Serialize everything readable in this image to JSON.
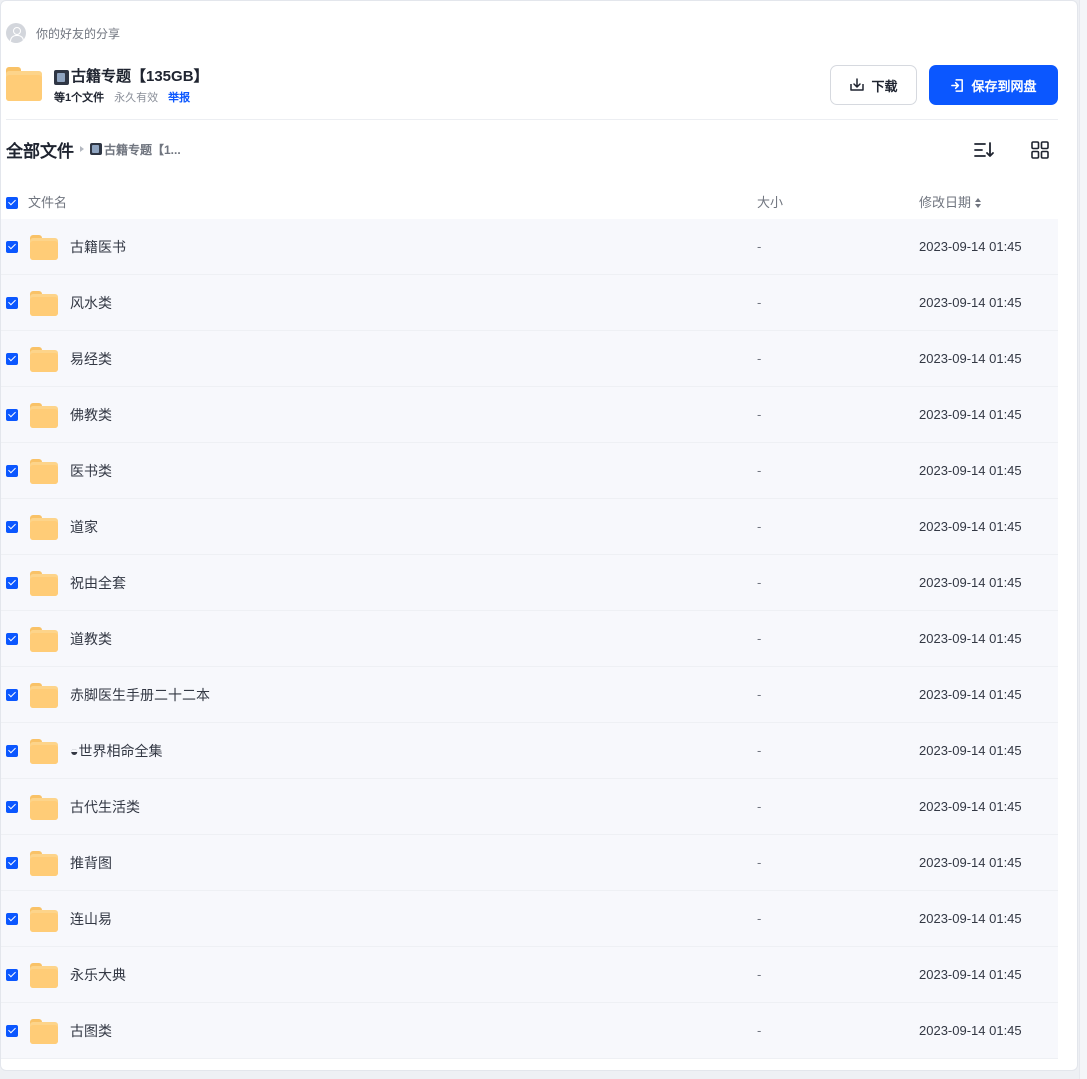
{
  "sharer": {
    "text": "你的好友的分享",
    "avatar_icon": "user-avatar-icon"
  },
  "share": {
    "title": "古籍专题【135GB】",
    "title_icon": "book-icon",
    "file_count": "等1个文件",
    "validity": "永久有效",
    "report_label": "举报"
  },
  "actions": {
    "download_label": "下载",
    "save_label": "保存到网盘",
    "primary_color": "#0b57ff"
  },
  "breadcrumb": {
    "root": "全部文件",
    "current": "古籍专题【1..."
  },
  "view_controls": {
    "list_icon": "list-sort-icon",
    "grid_icon": "grid-view-icon"
  },
  "table": {
    "columns": {
      "name": "文件名",
      "size": "大小",
      "date": "修改日期"
    },
    "rows": [
      {
        "name": "古籍医书",
        "size": "-",
        "date": "2023-09-14 01:45"
      },
      {
        "name": "风水类",
        "size": "-",
        "date": "2023-09-14 01:45"
      },
      {
        "name": "易经类",
        "size": "-",
        "date": "2023-09-14 01:45"
      },
      {
        "name": "佛教类",
        "size": "-",
        "date": "2023-09-14 01:45"
      },
      {
        "name": "医书类",
        "size": "-",
        "date": "2023-09-14 01:45"
      },
      {
        "name": "道家",
        "size": "-",
        "date": "2023-09-14 01:45"
      },
      {
        "name": "祝由全套",
        "size": "-",
        "date": "2023-09-14 01:45"
      },
      {
        "name": "道教类",
        "size": "-",
        "date": "2023-09-14 01:45"
      },
      {
        "name": "赤脚医生手册二十二本",
        "size": "-",
        "date": "2023-09-14 01:45"
      },
      {
        "name": "◒世界相命全集",
        "size": "-",
        "date": "2023-09-14 01:45"
      },
      {
        "name": "古代生活类",
        "size": "-",
        "date": "2023-09-14 01:45"
      },
      {
        "name": "推背图",
        "size": "-",
        "date": "2023-09-14 01:45"
      },
      {
        "name": "连山易",
        "size": "-",
        "date": "2023-09-14 01:45"
      },
      {
        "name": "永乐大典",
        "size": "-",
        "date": "2023-09-14 01:45"
      },
      {
        "name": "古图类",
        "size": "-",
        "date": "2023-09-14 01:45"
      }
    ]
  }
}
